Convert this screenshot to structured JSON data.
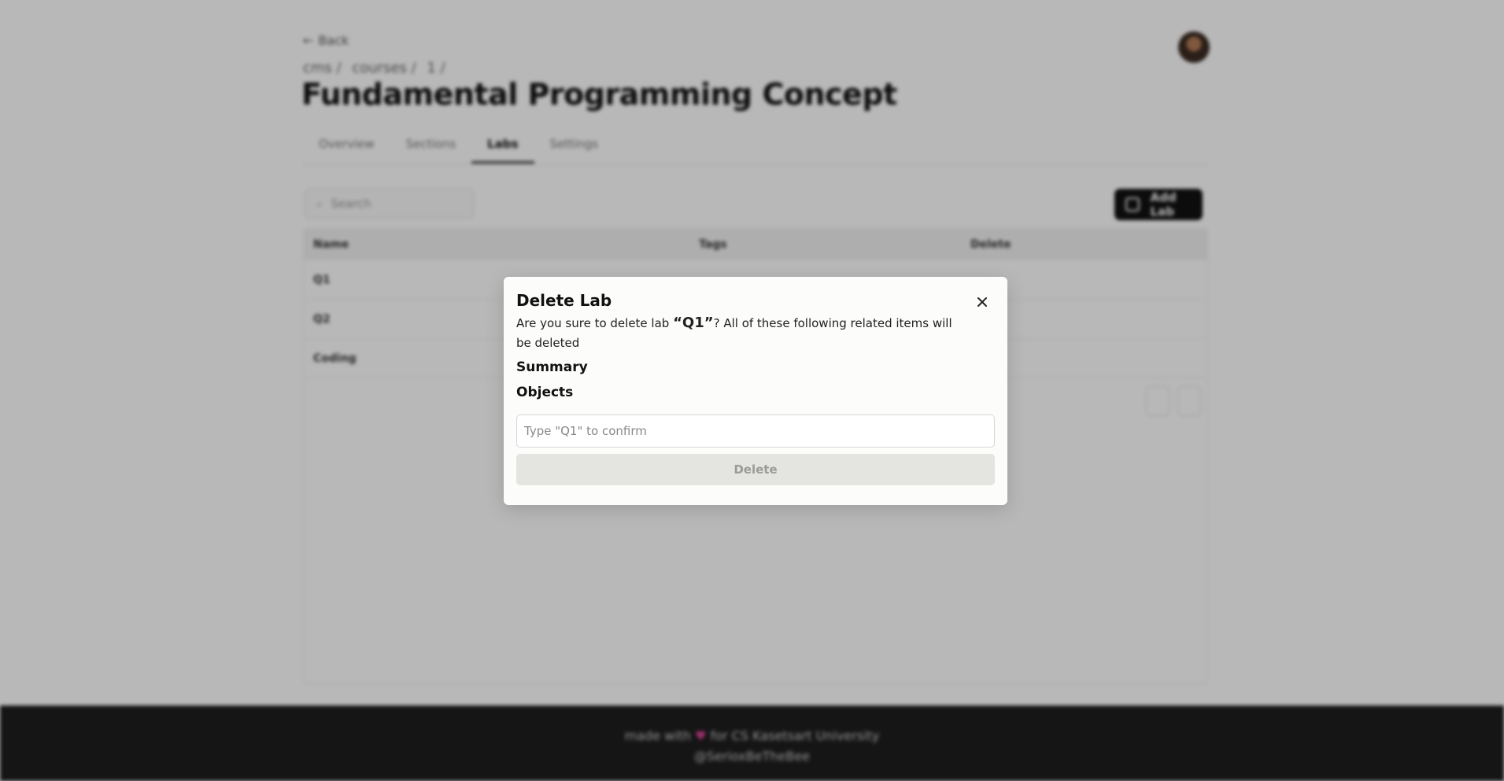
{
  "page": {
    "back_label": "Back",
    "breadcrumb": [
      "cms /",
      "courses /",
      "1 /"
    ],
    "title": "Fundamental Programming Concept",
    "tabs": [
      {
        "label": "Overview"
      },
      {
        "label": "Sections"
      },
      {
        "label": "Labs"
      },
      {
        "label": "Settings"
      }
    ],
    "search_placeholder": "Search",
    "add_button_label": "Add Lab",
    "table": {
      "headers": [
        "Name",
        "Tags",
        "Delete"
      ],
      "rows": [
        {
          "name": "Q1"
        },
        {
          "name": "Q2"
        },
        {
          "name": "Coding"
        }
      ]
    },
    "footer": {
      "line1_prefix": "made with",
      "line1_suffix": "for CS Kasetsart University",
      "line2": "@SerioxBeTheBee"
    }
  },
  "modal": {
    "title": "Delete Lab",
    "message_before": "Are you sure to delete lab ",
    "lab_name": "“Q1”",
    "message_after": "? All of these following related items will be deleted",
    "sections": [
      "Summary",
      "Objects"
    ],
    "confirm_placeholder": "Type \"Q1\" to confirm",
    "confirm_value": "",
    "delete_label": "Delete"
  },
  "colors": {
    "overlay": "#00000047",
    "modal_bg": "#fcfcfa",
    "delete_disabled_bg": "#e4e4e1",
    "delete_disabled_text": "#9a9a96",
    "footer_bg": "#1e1e1e",
    "heart": "#e0459a"
  },
  "icons": {
    "close": "close-icon",
    "back": "arrow-left-icon",
    "search": "search-icon",
    "add": "plus-square-icon",
    "heart": "heart-icon"
  }
}
